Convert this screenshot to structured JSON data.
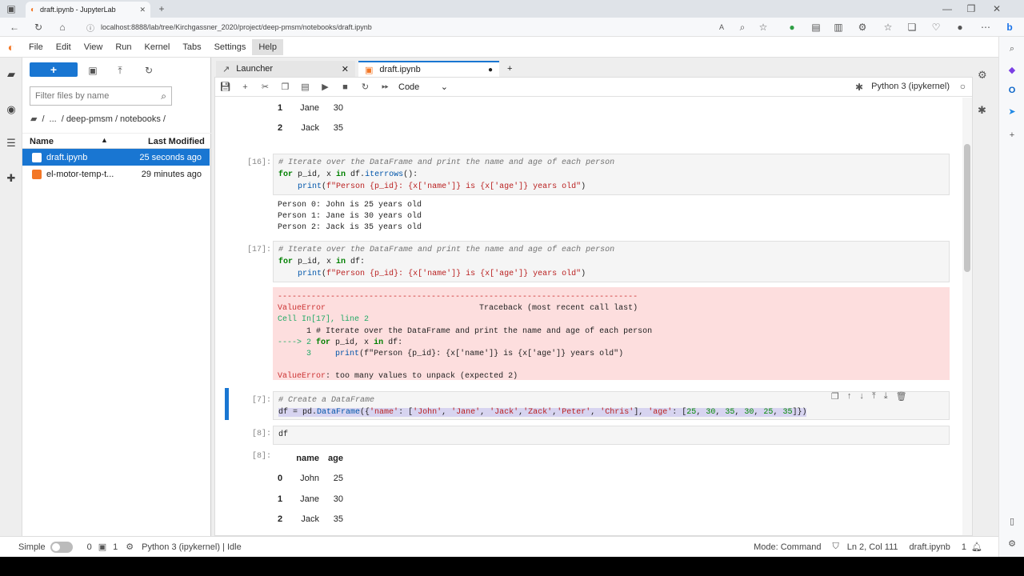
{
  "browser": {
    "tab_title": "draft.ipynb - JupyterLab",
    "url": "localhost:8888/lab/tree/Kirchgassner_2020/project/deep-pmsm/notebooks/draft.ipynb"
  },
  "menu": [
    "File",
    "Edit",
    "View",
    "Run",
    "Kernel",
    "Tabs",
    "Settings",
    "Help"
  ],
  "file_browser": {
    "new_label": "+",
    "filter_placeholder": "Filter files by name",
    "breadcrumb": [
      "/",
      "...",
      "/ deep-pmsm / notebooks /"
    ],
    "col_name": "Name",
    "col_modified": "Last Modified",
    "files": [
      {
        "name": "draft.ipynb",
        "modified": "25 seconds ago"
      },
      {
        "name": "el-motor-temp-t...",
        "modified": "29 minutes ago"
      }
    ]
  },
  "tabs": {
    "launcher": "Launcher",
    "notebook": "draft.ipynb"
  },
  "toolbar": {
    "cell_type": "Code",
    "kernel": "Python 3 (ipykernel)"
  },
  "cells": {
    "top_table": {
      "rows": [
        {
          "idx": "1",
          "name": "Jane",
          "age": "30"
        },
        {
          "idx": "2",
          "name": "Jack",
          "age": "35"
        }
      ]
    },
    "c16": {
      "prompt": "[16]:",
      "line1": "# Iterate over the DataFrame and print the name and age of each person",
      "output": "Person 0: John is 25 years old\nPerson 1: Jane is 30 years old\nPerson 2: Jack is 35 years old"
    },
    "c17": {
      "prompt": "[17]:",
      "line1": "# Iterate over the DataFrame and print the name and age of each person",
      "err_dashes": "---------------------------------------------------------------------------",
      "err_name": "ValueError",
      "err_traceback": "Traceback (most recent call last)",
      "err_cell": "Cell In[17], line 2",
      "err_line1": "      1 # Iterate over the DataFrame and print the name and age of each person",
      "err_msg": "too many values to unpack (expected 2)"
    },
    "c7": {
      "prompt": "[7]:",
      "line1": "# Create a DataFrame"
    },
    "c8": {
      "prompt": "[8]:",
      "code": "df",
      "out_prompt": "[8]:",
      "header": {
        "name": "name",
        "age": "age"
      },
      "rows": [
        {
          "idx": "0",
          "name": "John",
          "age": "25"
        },
        {
          "idx": "1",
          "name": "Jane",
          "age": "30"
        },
        {
          "idx": "2",
          "name": "Jack",
          "age": "35"
        }
      ]
    }
  },
  "status": {
    "mode_label": "Simple",
    "count_terminals": "0",
    "count_kernels": "1",
    "kernel_status": "Python 3 (ipykernel) | Idle",
    "mode": "Mode: Command",
    "cursor": "Ln 2, Col 111",
    "file": "draft.ipynb",
    "notif_count": "1"
  }
}
